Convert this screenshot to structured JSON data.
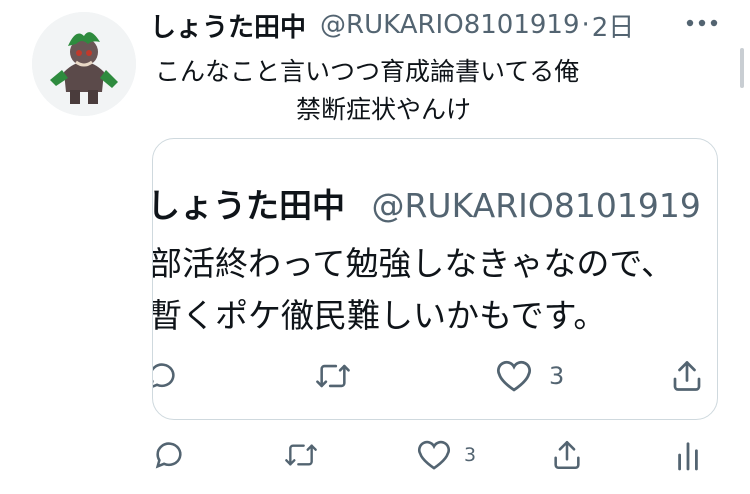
{
  "tweet": {
    "display_name": "しょうた田中",
    "handle": "@RUKARIO8101919",
    "separator": "·",
    "time": "2日",
    "text_line1": "こんなこと言いつつ育成論書いてる俺",
    "text_line2": "禁断症状やんけ",
    "avatar_icon": "pokemon-character-avatar"
  },
  "quoted": {
    "display_name": "しょうた田中",
    "handle": "@RUKARIO8101919",
    "text_line1": "部活終わって勉強しなきゃなので、",
    "text_line2": "暫くポケ徹民難しいかもです。",
    "like_count": "3"
  },
  "actions": {
    "like_count": "3"
  },
  "colors": {
    "text": "#0f1419",
    "secondary": "#536471",
    "border": "#cfd9de"
  }
}
